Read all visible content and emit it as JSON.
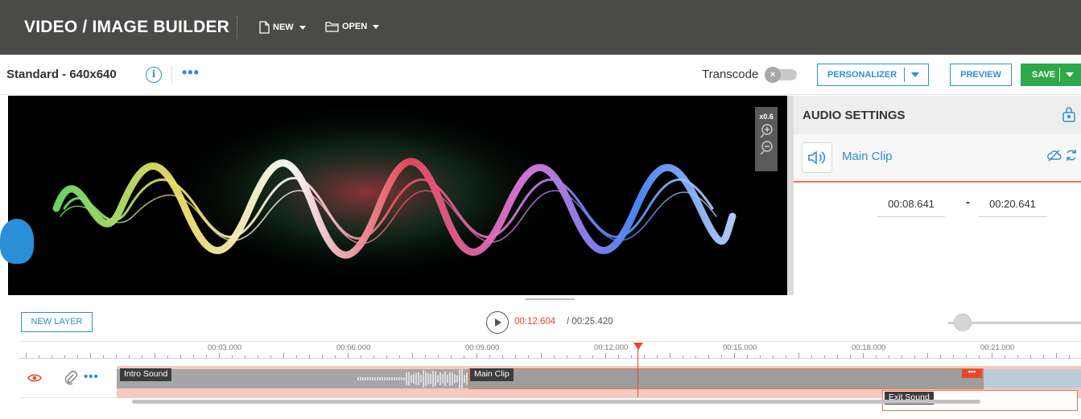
{
  "app": {
    "title": "VIDEO / IMAGE BUILDER",
    "menus": [
      {
        "label": "NEW",
        "icon": "file-icon"
      },
      {
        "label": "OPEN",
        "icon": "folder-icon"
      }
    ]
  },
  "toolbar": {
    "preset": "Standard - 640x640",
    "transcode_label": "Transcode",
    "transcode_on": false,
    "personalizer_label": "PERSONALIZER",
    "preview_label": "PREVIEW",
    "save_label": "SAVE"
  },
  "canvas": {
    "zoom_level": "x0.6"
  },
  "audio_settings": {
    "title": "AUDIO SETTINGS",
    "clip_name": "Main Clip",
    "start_time": "00:08.641",
    "dash": "-",
    "end_time": "00:20.641"
  },
  "timeline": {
    "new_layer_label": "NEW LAYER",
    "current_time": "00:12.604",
    "separator": " / ",
    "total_time": "00:25.420",
    "ruler_labels": [
      "00:03.000",
      "00:06.000",
      "00:09.000",
      "00:12.000",
      "00:15.000",
      "00:18.000",
      "00:21.000"
    ],
    "layer": {
      "dots": "•••",
      "clips": [
        {
          "label": "Intro Sound"
        },
        {
          "label": "Main Clip"
        },
        {
          "label": "Exit Sound"
        }
      ],
      "clip_menu_dots": "•••"
    }
  },
  "colors": {
    "accent": "#2b8fd6",
    "save_green": "#2ea84a",
    "playhead": "#e8472e",
    "topbar": "#4a4a48"
  }
}
